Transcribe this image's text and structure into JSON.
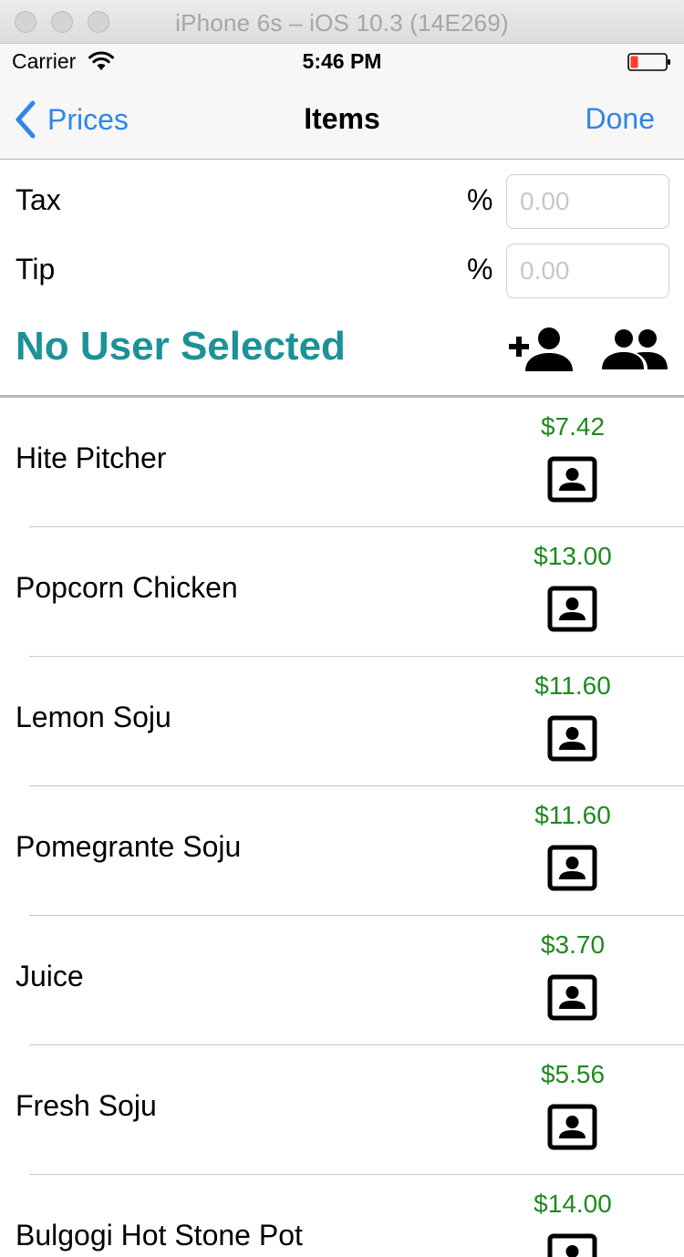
{
  "window": {
    "title": "iPhone 6s – iOS 10.3 (14E269)"
  },
  "status_bar": {
    "carrier": "Carrier",
    "time": "5:46 PM",
    "battery_color": "#ff3b30"
  },
  "nav": {
    "back_label": "Prices",
    "title": "Items",
    "done_label": "Done"
  },
  "tax": {
    "label": "Tax",
    "unit": "%",
    "placeholder": "0.00",
    "value": ""
  },
  "tip": {
    "label": "Tip",
    "unit": "%",
    "placeholder": "0.00",
    "value": ""
  },
  "user": {
    "status": "No User Selected",
    "add_icon": "add-person-icon",
    "group_icon": "group-icon"
  },
  "colors": {
    "accent": "#2f86e9",
    "user_status": "#1b9296",
    "price": "#1f8a1f"
  },
  "items": [
    {
      "name": "Hite Pitcher",
      "price": "$7.42",
      "icon": "contact-portrait-icon"
    },
    {
      "name": "Popcorn Chicken",
      "price": "$13.00",
      "icon": "contact-portrait-icon"
    },
    {
      "name": "Lemon Soju",
      "price": "$11.60",
      "icon": "contact-portrait-icon"
    },
    {
      "name": "Pomegrante Soju",
      "price": "$11.60",
      "icon": "contact-portrait-icon"
    },
    {
      "name": "Juice",
      "price": "$3.70",
      "icon": "contact-portrait-icon"
    },
    {
      "name": "Fresh Soju",
      "price": "$5.56",
      "icon": "contact-portrait-icon"
    },
    {
      "name": "Bulgogi Hot Stone Pot",
      "price": "$14.00",
      "icon": "contact-portrait-icon"
    }
  ]
}
